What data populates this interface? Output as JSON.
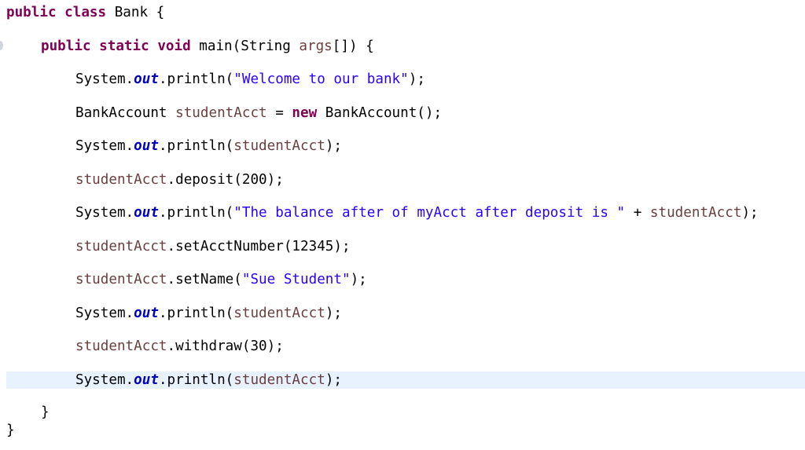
{
  "editor": {
    "language": "java",
    "current_line_index": 11,
    "lines": [
      {
        "indent": 0,
        "tokens": [
          {
            "t": "public",
            "c": "kw"
          },
          {
            "t": " "
          },
          {
            "t": "class",
            "c": "kw"
          },
          {
            "t": " Bank {"
          }
        ]
      },
      {
        "indent": 1,
        "tokens": [
          {
            "t": "public",
            "c": "kw"
          },
          {
            "t": " "
          },
          {
            "t": "static",
            "c": "kw"
          },
          {
            "t": " "
          },
          {
            "t": "void",
            "c": "kw"
          },
          {
            "t": " main(String "
          },
          {
            "t": "args",
            "c": "var"
          },
          {
            "t": "[]) {"
          }
        ]
      },
      {
        "indent": 2,
        "tokens": [
          {
            "t": "System."
          },
          {
            "t": "out",
            "c": "field"
          },
          {
            "t": ".println("
          },
          {
            "t": "\"Welcome to our bank\"",
            "c": "str"
          },
          {
            "t": ");"
          }
        ]
      },
      {
        "indent": 2,
        "tokens": [
          {
            "t": "BankAccount "
          },
          {
            "t": "studentAcct",
            "c": "var"
          },
          {
            "t": " = "
          },
          {
            "t": "new",
            "c": "kw"
          },
          {
            "t": " BankAccount();"
          }
        ]
      },
      {
        "indent": 2,
        "tokens": [
          {
            "t": "System."
          },
          {
            "t": "out",
            "c": "field"
          },
          {
            "t": ".println("
          },
          {
            "t": "studentAcct",
            "c": "var"
          },
          {
            "t": ");"
          }
        ]
      },
      {
        "indent": 2,
        "tokens": [
          {
            "t": "studentAcct",
            "c": "var"
          },
          {
            "t": ".deposit(200);"
          }
        ]
      },
      {
        "indent": 2,
        "tokens": [
          {
            "t": "System."
          },
          {
            "t": "out",
            "c": "field"
          },
          {
            "t": ".println("
          },
          {
            "t": "\"The balance after of myAcct after deposit is \"",
            "c": "str"
          },
          {
            "t": " + "
          },
          {
            "t": "studentAcct",
            "c": "var"
          },
          {
            "t": ");"
          }
        ]
      },
      {
        "indent": 2,
        "tokens": [
          {
            "t": "studentAcct",
            "c": "var"
          },
          {
            "t": ".setAcctNumber(12345);"
          }
        ]
      },
      {
        "indent": 2,
        "tokens": [
          {
            "t": "studentAcct",
            "c": "var"
          },
          {
            "t": ".setName("
          },
          {
            "t": "\"Sue Student\"",
            "c": "str"
          },
          {
            "t": ");"
          }
        ]
      },
      {
        "indent": 2,
        "tokens": [
          {
            "t": "System."
          },
          {
            "t": "out",
            "c": "field"
          },
          {
            "t": ".println("
          },
          {
            "t": "studentAcct",
            "c": "var"
          },
          {
            "t": ");"
          }
        ]
      },
      {
        "indent": 2,
        "tokens": [
          {
            "t": "studentAcct",
            "c": "var"
          },
          {
            "t": ".withdraw(30);"
          }
        ]
      },
      {
        "indent": 2,
        "tokens": [
          {
            "t": "System."
          },
          {
            "t": "out",
            "c": "field"
          },
          {
            "t": ".println("
          },
          {
            "t": "studentAcct",
            "c": "var"
          },
          {
            "t": ");"
          }
        ]
      },
      {
        "indent": 1,
        "tokens": [
          {
            "t": "}"
          }
        ]
      },
      {
        "indent": 0,
        "tokens": [
          {
            "t": "}"
          }
        ]
      }
    ]
  }
}
